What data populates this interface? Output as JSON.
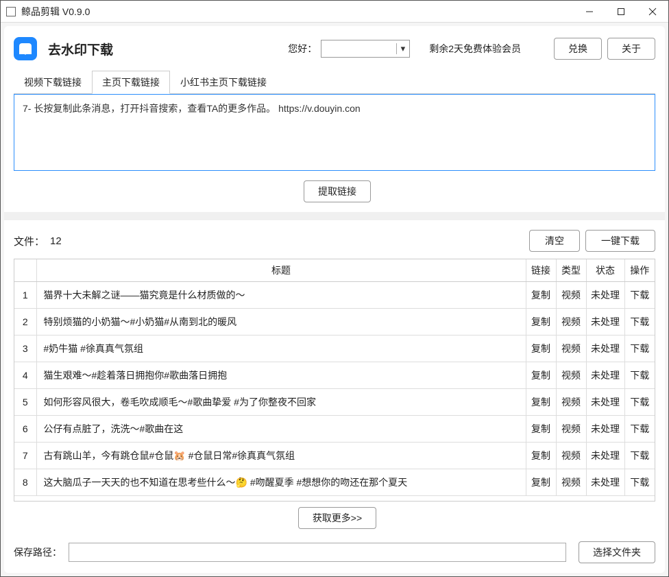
{
  "window": {
    "title": "鲸品剪辑 V0.9.0"
  },
  "header": {
    "page_title": "去水印下载",
    "greeting": "您好：",
    "user_dropdown_caret": "▾",
    "trial": "剩余2天免费体验会员",
    "exchange": "兑换",
    "about": "关于"
  },
  "tabs": [
    {
      "label": "视频下载链接"
    },
    {
      "label": "主页下载链接"
    },
    {
      "label": "小红书主页下载链接"
    }
  ],
  "active_tab": 1,
  "link_text": "7- 长按复制此条消息，打开抖音搜索，查看TA的更多作品。 https://v.douyin.con",
  "extract_btn": "提取链接",
  "files": {
    "label": "文件：",
    "count": "12",
    "clear": "清空",
    "download_all": "一键下载"
  },
  "table": {
    "cols": {
      "title": "标题",
      "link": "链接",
      "type": "类型",
      "status": "状态",
      "op": "操作"
    },
    "rows": [
      {
        "idx": "1",
        "title": "猫界十大未解之谜——猫究竟是什么材质做的～",
        "link": "复制",
        "type": "视频",
        "status": "未处理",
        "op": "下载"
      },
      {
        "idx": "2",
        "title": "特别烦猫的小奶猫～#小奶猫#从南到北的暖风",
        "link": "复制",
        "type": "视频",
        "status": "未处理",
        "op": "下载"
      },
      {
        "idx": "3",
        "title": "#奶牛猫 #徐真真气氛组",
        "link": "复制",
        "type": "视频",
        "status": "未处理",
        "op": "下载"
      },
      {
        "idx": "4",
        "title": "猫生艰难～#趁着落日拥抱你#歌曲落日拥抱",
        "link": "复制",
        "type": "视频",
        "status": "未处理",
        "op": "下载"
      },
      {
        "idx": "5",
        "title": "如何形容风很大，卷毛吹成顺毛～#歌曲挚爱 #为了你整夜不回家",
        "link": "复制",
        "type": "视频",
        "status": "未处理",
        "op": "下载"
      },
      {
        "idx": "6",
        "title": "公仔有点脏了，洗洗～#歌曲在这",
        "link": "复制",
        "type": "视频",
        "status": "未处理",
        "op": "下载"
      },
      {
        "idx": "7",
        "title": "古有跳山羊，今有跳仓鼠#仓鼠🐹 #仓鼠日常#徐真真气氛组",
        "link": "复制",
        "type": "视频",
        "status": "未处理",
        "op": "下载"
      },
      {
        "idx": "8",
        "title": "这大脑瓜子一天天的也不知道在思考些什么～🤔 #吻醒夏季 #想想你的吻还在那个夏天",
        "link": "复制",
        "type": "视频",
        "status": "未处理",
        "op": "下载"
      }
    ]
  },
  "more_btn": "获取更多>>",
  "save": {
    "label": "保存路径：",
    "value": "",
    "choose": "选择文件夹"
  }
}
